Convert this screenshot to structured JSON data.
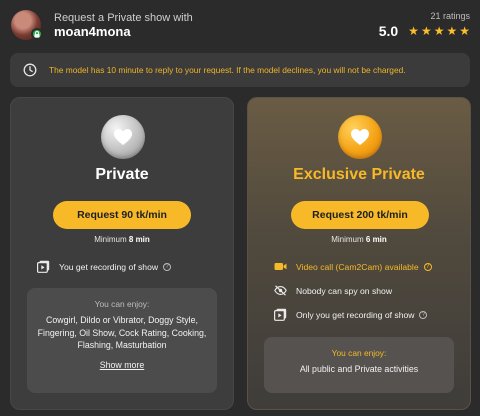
{
  "header": {
    "subtitle": "Request a Private show with",
    "username": "moan4mona",
    "ratings_count": "21 ratings",
    "rating_value": "5.0",
    "stars": 5
  },
  "notice": {
    "text": "The model has 10 minute to reply to your request. If the model declines, you will not be charged.",
    "icon": "clock-icon"
  },
  "private": {
    "title": "Private",
    "button": "Request 90 tk/min",
    "minimum_label": "Minimum",
    "minimum_value": "8 min",
    "features": [
      {
        "icon": "recording-icon",
        "text": "You get recording of show"
      }
    ],
    "enjoy_heading": "You can enjoy:",
    "enjoy_text": "Cowgirl, Dildo or Vibrator, Doggy Style, Fingering, Oil Show, Cock Rating, Cooking, Flashing, Masturbation",
    "show_more": "Show more"
  },
  "exclusive": {
    "title": "Exclusive Private",
    "button": "Request 200 tk/min",
    "minimum_label": "Minimum",
    "minimum_value": "6 min",
    "features": [
      {
        "icon": "video-camera-icon",
        "text": "Video call (Cam2Cam) available"
      },
      {
        "icon": "eye-off-icon",
        "text": "Nobody can spy on show"
      },
      {
        "icon": "recording-icon",
        "text": "Only you get recording of show"
      }
    ],
    "enjoy_heading": "You can enjoy:",
    "enjoy_text": "All public and Private activities"
  },
  "colors": {
    "accent": "#f7b928",
    "background": "#2b2b2b",
    "card": "#3d3d3d"
  }
}
